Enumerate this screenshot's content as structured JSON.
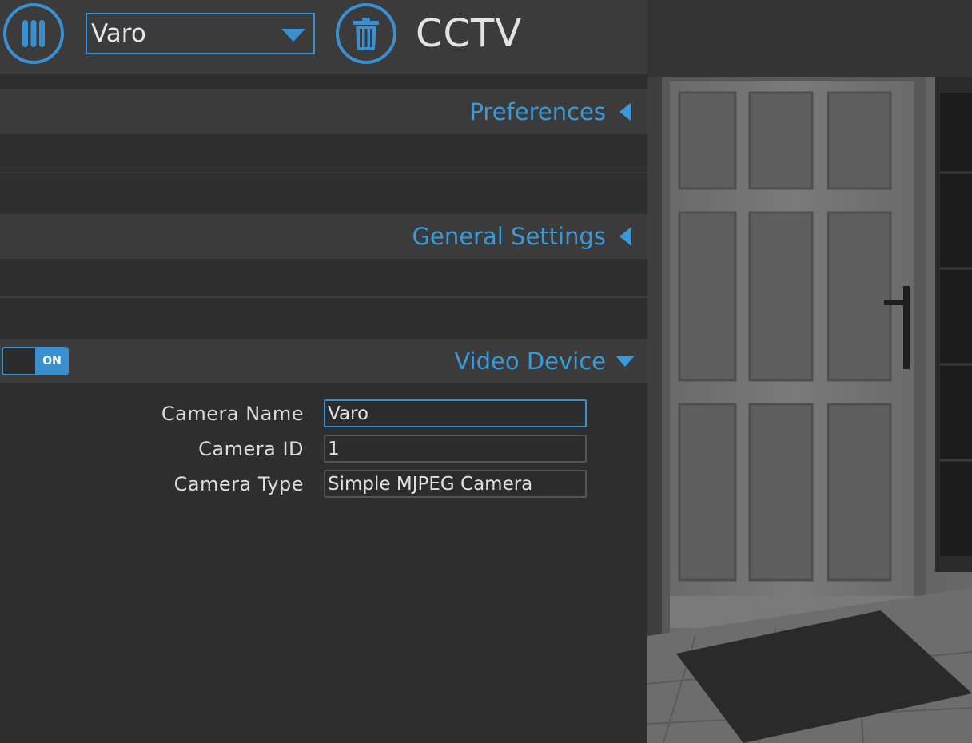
{
  "header": {
    "selected_camera": "Varo",
    "app_title": "CCTV",
    "menu_icon": "menu-bars-icon",
    "trash_icon": "trash-icon",
    "accent_color": "#3a8fd0"
  },
  "sections": {
    "preferences": {
      "label": "Preferences",
      "state": "collapsed"
    },
    "general_settings": {
      "label": "General Settings",
      "state": "collapsed"
    },
    "video_device": {
      "label": "Video Device",
      "state": "expanded",
      "toggle_label": "ON"
    }
  },
  "video_device_form": {
    "camera_name_label": "Camera Name",
    "camera_name_value": "Varo",
    "camera_id_label": "Camera ID",
    "camera_id_value": "1",
    "camera_type_label": "Camera Type",
    "camera_type_value": "Simple MJPEG Camera"
  }
}
